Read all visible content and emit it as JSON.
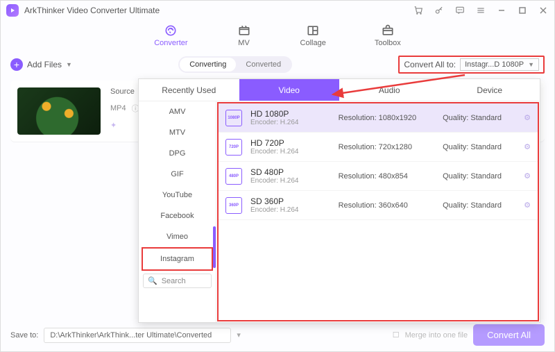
{
  "titlebar": {
    "app_name": "ArkThinker Video Converter Ultimate"
  },
  "mainnav": {
    "converter": "Converter",
    "mv": "MV",
    "collage": "Collage",
    "toolbox": "Toolbox"
  },
  "toolbar": {
    "add_files": "Add Files",
    "converting": "Converting",
    "converted": "Converted",
    "convert_all_to": "Convert All to:",
    "convert_all_value": "Instagr...D 1080P"
  },
  "file": {
    "source_label": "Source",
    "fmt": "MP4"
  },
  "popup": {
    "tabs": {
      "recent": "Recently Used",
      "video": "Video",
      "audio": "Audio",
      "device": "Device"
    },
    "categories": [
      "AMV",
      "MTV",
      "DPG",
      "GIF",
      "YouTube",
      "Facebook",
      "Vimeo",
      "Instagram"
    ],
    "search": "Search",
    "formats": [
      {
        "name": "HD 1080P",
        "encoder": "Encoder: H.264",
        "res": "Resolution: 1080x1920",
        "q": "Quality: Standard",
        "icon": "1080P"
      },
      {
        "name": "HD 720P",
        "encoder": "Encoder: H.264",
        "res": "Resolution: 720x1280",
        "q": "Quality: Standard",
        "icon": "720P"
      },
      {
        "name": "SD 480P",
        "encoder": "Encoder: H.264",
        "res": "Resolution: 480x854",
        "q": "Quality: Standard",
        "icon": "480P"
      },
      {
        "name": "SD 360P",
        "encoder": "Encoder: H.264",
        "res": "Resolution: 360x640",
        "q": "Quality: Standard",
        "icon": "360P"
      }
    ]
  },
  "bottom": {
    "save_to": "Save to:",
    "path": "D:\\ArkThinker\\ArkThink...ter Ultimate\\Converted",
    "merge": "Merge into one file",
    "convert_all": "Convert All"
  }
}
